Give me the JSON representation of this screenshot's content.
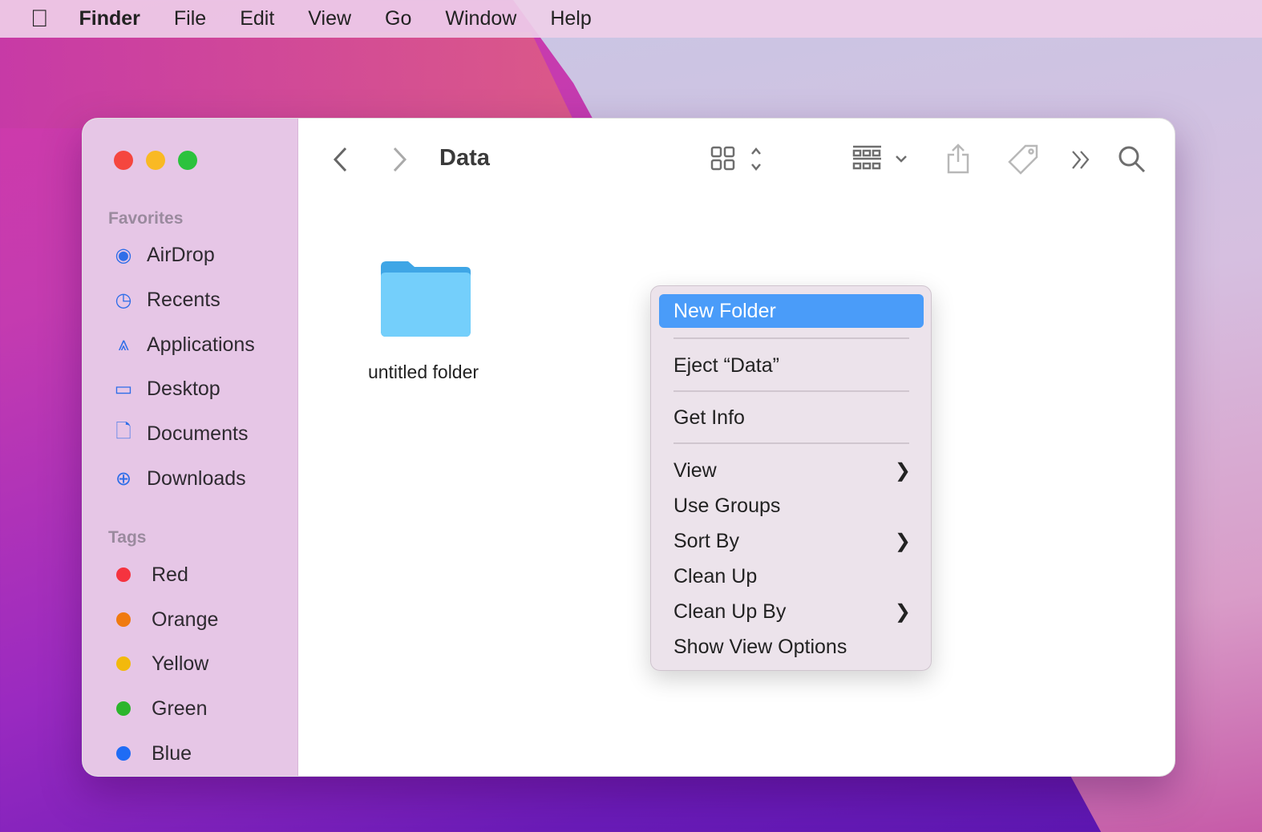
{
  "menubar": {
    "app": "Finder",
    "items": [
      "File",
      "Edit",
      "View",
      "Go",
      "Window",
      "Help"
    ]
  },
  "window": {
    "title": "Data"
  },
  "sidebar": {
    "favorites_label": "Favorites",
    "favorites": [
      {
        "label": "AirDrop",
        "icon": "airdrop-icon"
      },
      {
        "label": "Recents",
        "icon": "clock-icon"
      },
      {
        "label": "Applications",
        "icon": "applications-icon"
      },
      {
        "label": "Desktop",
        "icon": "desktop-icon"
      },
      {
        "label": "Documents",
        "icon": "document-icon"
      },
      {
        "label": "Downloads",
        "icon": "download-icon"
      }
    ],
    "tags_label": "Tags",
    "tags": [
      {
        "label": "Red",
        "color": "#f5333f"
      },
      {
        "label": "Orange",
        "color": "#f07a10"
      },
      {
        "label": "Yellow",
        "color": "#f2b90c"
      },
      {
        "label": "Green",
        "color": "#2cb52c"
      },
      {
        "label": "Blue",
        "color": "#1f6cf5"
      }
    ]
  },
  "content": {
    "items": [
      {
        "label": "untitled folder"
      }
    ]
  },
  "context_menu": {
    "items": [
      "New Folder",
      "Eject “Data”",
      "Get Info",
      "View",
      "Use Groups",
      "Sort By",
      "Clean Up",
      "Clean Up By",
      "Show View Options"
    ]
  },
  "colors": {
    "accent": "#4a9cf9",
    "folder": "#6ecbfa"
  }
}
